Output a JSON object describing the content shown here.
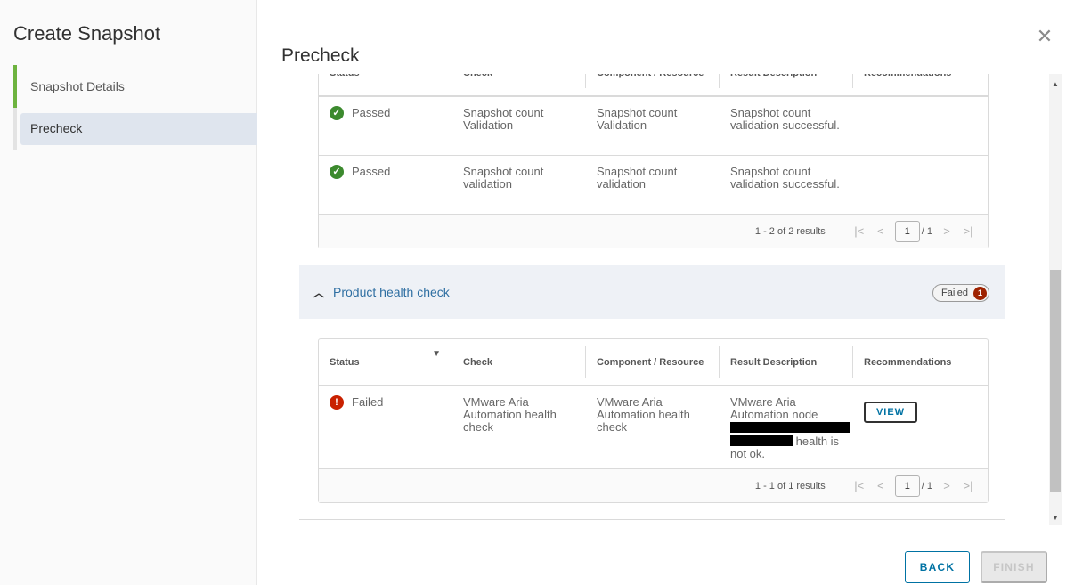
{
  "wizard": {
    "title": "Create Snapshot",
    "steps": [
      {
        "label": "Snapshot Details"
      },
      {
        "label": "Precheck"
      }
    ]
  },
  "page": {
    "title": "Precheck",
    "close_icon": "close-icon"
  },
  "columns": [
    "Status",
    "Check",
    "Component / Resource",
    "Result Description",
    "Recommendations"
  ],
  "table1": {
    "rows": [
      {
        "status": "Passed",
        "check": "Snapshot count Validation",
        "resource": "Snapshot count Validation",
        "result": "Snapshot count validation successful."
      },
      {
        "status": "Passed",
        "check": "Snapshot count validation",
        "resource": "Snapshot count validation",
        "result": "Snapshot count validation successful."
      }
    ],
    "summary": "1 - 2 of 2 results",
    "page": "1",
    "pages": "/ 1"
  },
  "section": {
    "title": "Product health check",
    "badge_label": "Failed",
    "badge_count": "1"
  },
  "table2": {
    "rows": [
      {
        "status": "Failed",
        "check": "VMware Aria Automation health check",
        "resource": "VMware Aria Automation health check",
        "result_start": "VMware Aria Automation node",
        "result_end": "health is not ok.",
        "action": "VIEW"
      }
    ],
    "summary": "1 - 1 of 1 results",
    "page": "1",
    "pages": "/ 1"
  },
  "footer": {
    "back": "BACK",
    "finish": "FINISH"
  },
  "colors": {
    "accent": "#0072a3",
    "passed": "#3c8a2e",
    "failed": "#c92100",
    "step_done": "#6db33f"
  }
}
